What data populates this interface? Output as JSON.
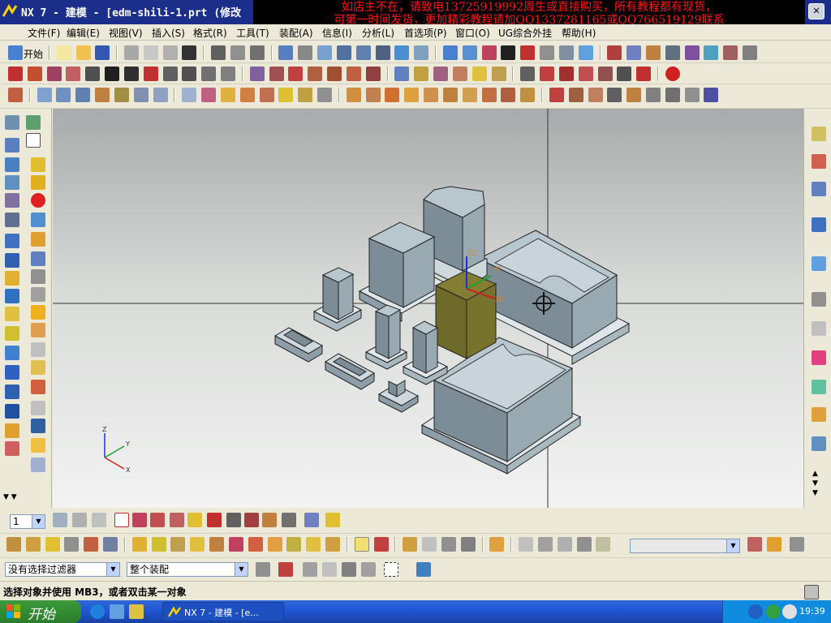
{
  "window": {
    "title": "NX 7 - 建模 - [edm-shili-1.prt  (修改",
    "overlay_line1": "如店主不在，请致电13725919992周生或直接购买，所有教程都有现货，",
    "overlay_line2": "可第一时间发货，更加精彩教程请加QQ1337281165或QQ766519129联系"
  },
  "menu": [
    "文件(F)",
    "编辑(E)",
    "视图(V)",
    "插入(S)",
    "格式(R)",
    "工具(T)",
    "装配(A)",
    "信息(I)",
    "分析(L)",
    "首选项(P)",
    "窗口(O)",
    "UG综合外挂",
    "帮助(H)"
  ],
  "toolbar": {
    "start_label": "开始"
  },
  "layer_combo": "1",
  "filter": {
    "selection_filter": "没有选择过滤器",
    "assembly_scope": "整个装配"
  },
  "status_message": "选择对象并使用 MB3，或者双击某一对象",
  "triad": {
    "x": "X",
    "y": "Y",
    "z": "Z"
  },
  "wcs": {
    "xc": "XC",
    "yc": "YC",
    "zc": "ZC"
  },
  "taskbar": {
    "start": "开始",
    "item": "NX 7 - 建模 - [e...",
    "clock": "19:39"
  },
  "colors": {
    "titlebar": "#1b2f8a",
    "overlay_text": "#ff1414",
    "part_fill": "#7d8d96",
    "highlight": "#6e6a2a"
  }
}
